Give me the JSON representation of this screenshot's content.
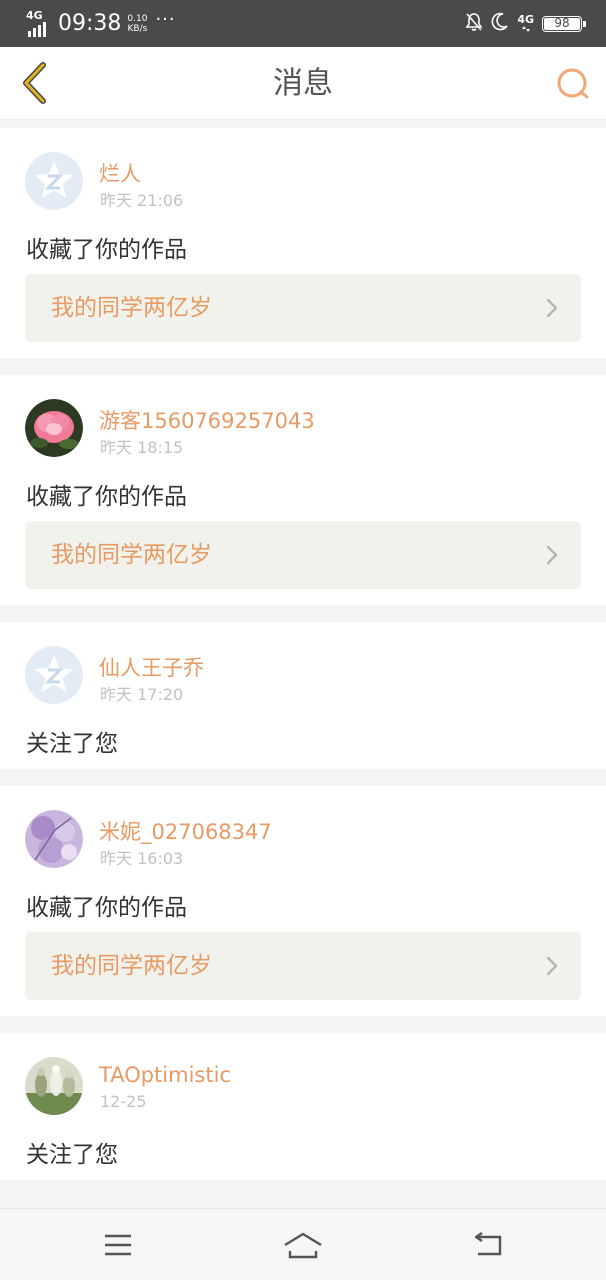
{
  "status_bar": {
    "network": "4G",
    "time": "09:38",
    "speed_value": "0.10",
    "speed_unit": "KB/s",
    "more": "···",
    "network2": "4G",
    "battery": "98",
    "icons": [
      "signal-icon",
      "notification-off-icon",
      "moon-icon",
      "data-arrows-icon",
      "battery-icon"
    ]
  },
  "header": {
    "title": "消息",
    "back_icon": "chevron-left-icon",
    "search_icon": "search-icon",
    "accent": "#e0b420",
    "search_color": "#f0a774"
  },
  "messages": [
    {
      "username": "烂人",
      "time": "昨天 21:06",
      "action": "收藏了你的作品",
      "work": "我的同学两亿岁",
      "avatar": "qq-default-avatar"
    },
    {
      "username": "游客1560769257043",
      "time": "昨天 18:15",
      "action": "收藏了你的作品",
      "work": "我的同学两亿岁",
      "avatar": "pink-rose-avatar"
    },
    {
      "username": "仙人王子乔",
      "time": "昨天 17:20",
      "action": "关注了您",
      "avatar": "qq-default-avatar"
    },
    {
      "username": "米妮_027068347",
      "time": "昨天 16:03",
      "action": "收藏了你的作品",
      "work": "我的同学两亿岁",
      "avatar": "purple-blossom-avatar"
    },
    {
      "username": "TAOptimistic",
      "time": "12-25",
      "action": "关注了您",
      "avatar": "figures-photo-avatar"
    }
  ],
  "colors": {
    "username": "#e89a64",
    "timestamp": "#c2c2c2",
    "action_text": "#333333",
    "work_bg": "#f2f2ec",
    "page_bg": "#f4f4f4"
  },
  "nav_bar": {
    "icons": [
      "menu-icon",
      "home-icon",
      "back-icon"
    ]
  }
}
